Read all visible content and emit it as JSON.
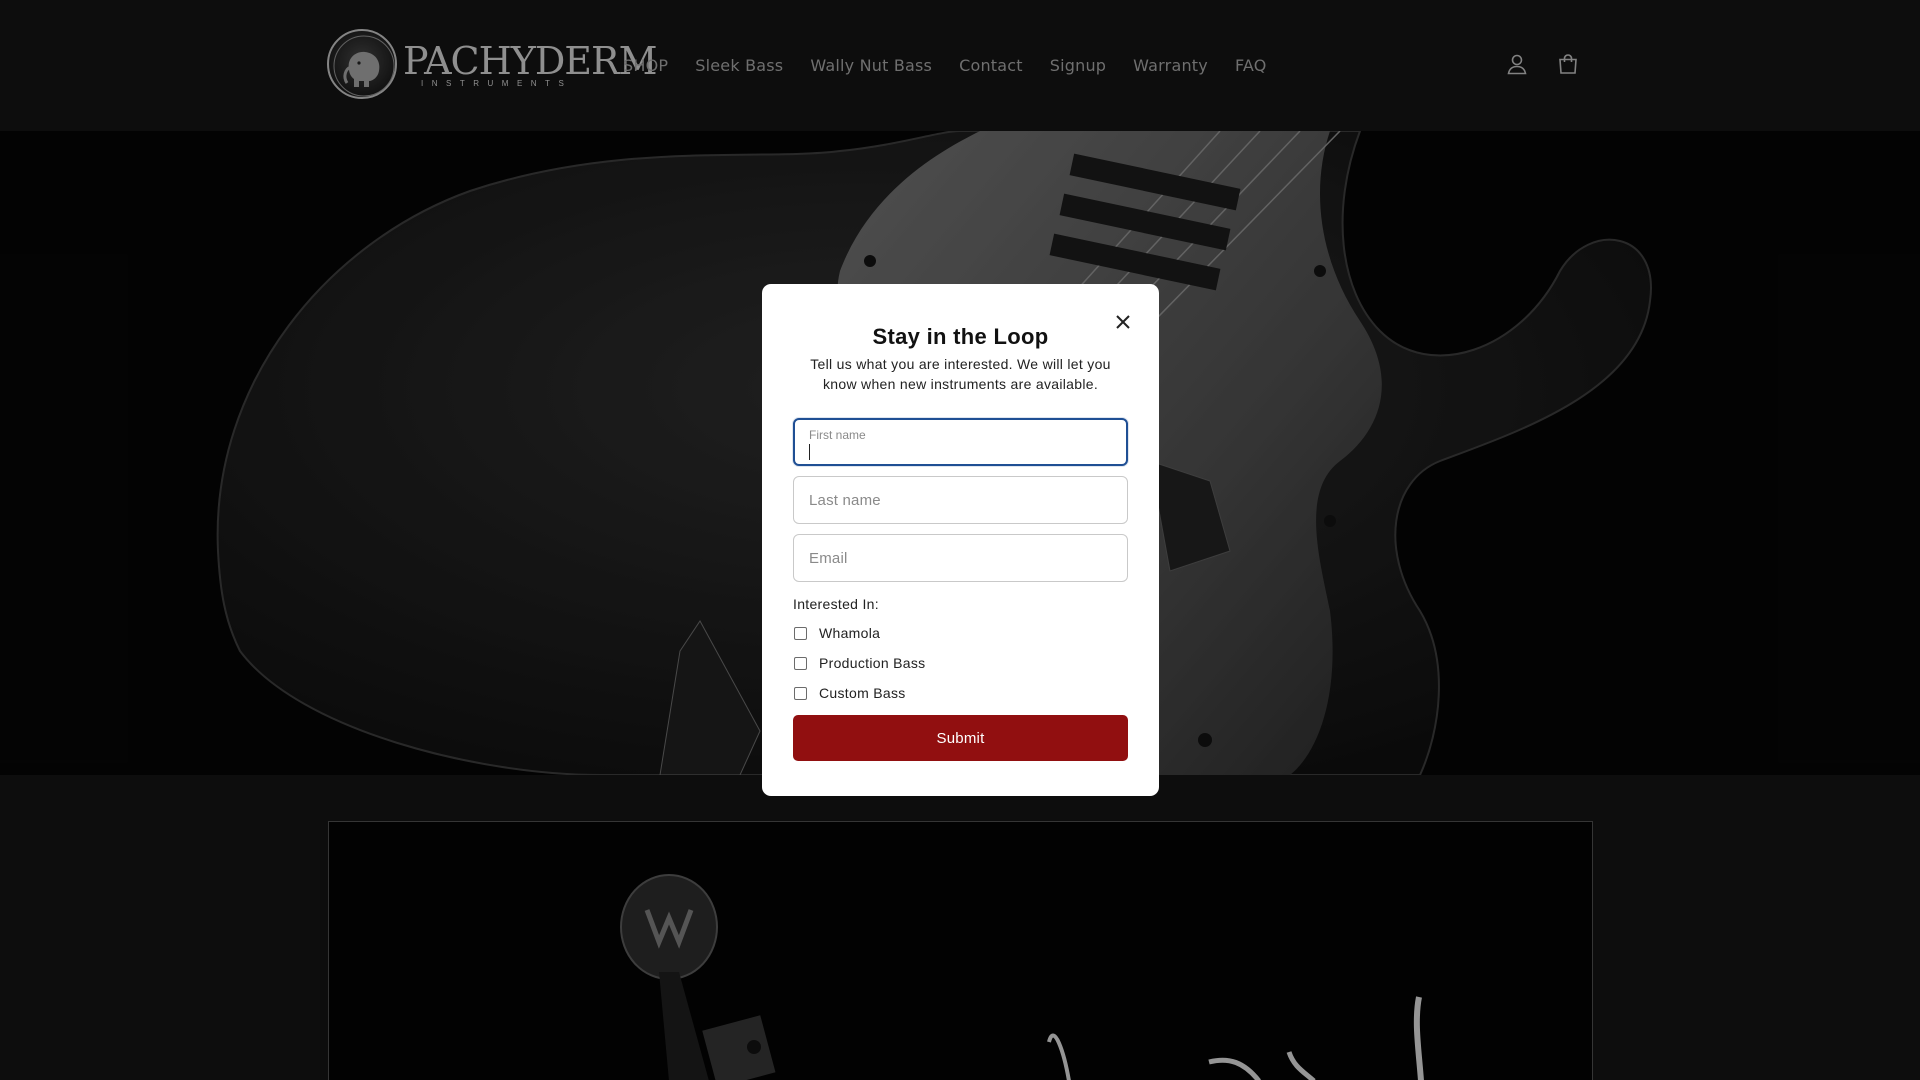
{
  "brand": {
    "logo_text": "PACHYDERM",
    "logo_subtext": "INSTRUMENTS"
  },
  "nav": {
    "items": [
      {
        "label": "SHOP"
      },
      {
        "label": "Sleek Bass"
      },
      {
        "label": "Wally Nut Bass"
      },
      {
        "label": "Contact"
      },
      {
        "label": "Signup"
      },
      {
        "label": "Warranty"
      },
      {
        "label": "FAQ"
      }
    ]
  },
  "header_icons": [
    "account-icon",
    "cart-icon"
  ],
  "modal": {
    "title": "Stay in the Loop",
    "description": "Tell us what you are interested. We will let you know when new instruments are available.",
    "close_icon": "close-icon",
    "fields": {
      "first_name": {
        "label": "First name",
        "value": ""
      },
      "last_name": {
        "placeholder": "Last name",
        "value": ""
      },
      "email": {
        "placeholder": "Email",
        "value": ""
      }
    },
    "interest_label": "Interested In:",
    "options": [
      {
        "label": "Whamola",
        "checked": false
      },
      {
        "label": "Production Bass",
        "checked": false
      },
      {
        "label": "Custom Bass",
        "checked": false
      }
    ],
    "submit_label": "Submit"
  },
  "colors": {
    "page_bg": "#121212",
    "nav_text": "#9a9a9a",
    "submit_bg": "#910f10",
    "focus_border": "#1f4f94",
    "modal_bg": "#ffffff"
  }
}
